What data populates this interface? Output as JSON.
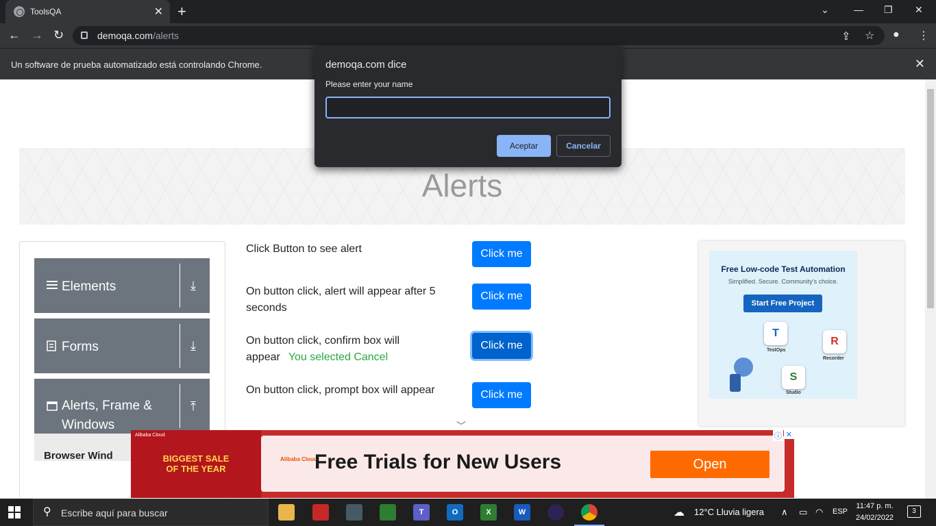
{
  "browser": {
    "tab_title": "ToolsQA",
    "new_tab": "+",
    "url_domain": "demoqa.com",
    "url_path": "/alerts",
    "infobar_message": "Un software de prueba automatizado está controlando Chrome."
  },
  "dialog": {
    "title": "demoqa.com dice",
    "message": "Please enter your name",
    "input_value": "",
    "ok_label": "Aceptar",
    "cancel_label": "Cancelar"
  },
  "page": {
    "heading": "Alerts",
    "rows": [
      {
        "text": "Click Button to see alert",
        "button": "Click me"
      },
      {
        "text": "On button click, alert will appear after 5 seconds",
        "button": "Click me"
      },
      {
        "text": "On button click, confirm box will appear",
        "result": "You selected Cancel",
        "button": "Click me"
      },
      {
        "text": "On button click, prompt box will appear",
        "button": "Click me"
      }
    ]
  },
  "sidebar": {
    "groups": [
      {
        "label": "Elements",
        "icon": "menu-icon",
        "arrow": "download-arrow-icon"
      },
      {
        "label": "Forms",
        "icon": "document-icon",
        "arrow": "download-arrow-icon"
      },
      {
        "label": "Alerts, Frame & Windows",
        "icon": "window-icon",
        "arrow": "upload-arrow-icon"
      }
    ],
    "subitem": "Browser Wind"
  },
  "ad_right": {
    "title": "Free Low-code Test Automation",
    "subtitle": "Simplified. Secure. Community's choice.",
    "cta": "Start Free Project",
    "labels": [
      "TestOps",
      "Recorder",
      "Studio"
    ]
  },
  "ad_bottom": {
    "brand": "Alibaba Cloud",
    "sale_line1": "BIGGEST SALE",
    "sale_line2": "OF THE YEAR",
    "headline": "Free Trials for New Users",
    "button": "Open"
  },
  "taskbar": {
    "search_placeholder": "Escribe aquí para buscar",
    "weather": "12°C  Lluvia ligera",
    "language": "ESP",
    "time": "11:47 p. m.",
    "date": "24/02/2022",
    "notifications": "3"
  }
}
